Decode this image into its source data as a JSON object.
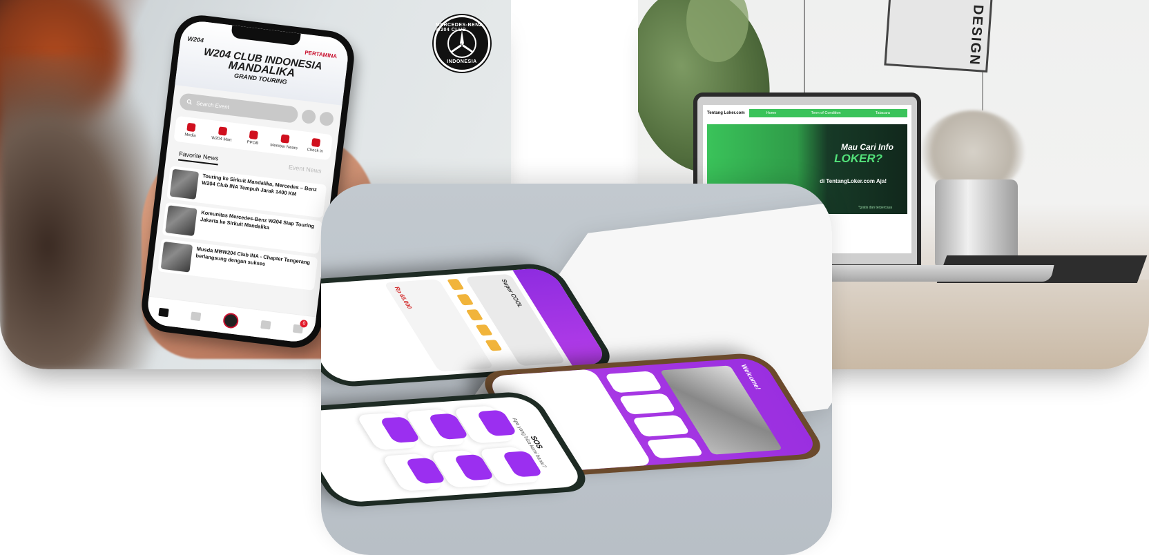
{
  "panel_a": {
    "badge": {
      "top": "MERCEDES-BENZ W204 CLUB",
      "bottom": "INDONESIA"
    },
    "app": {
      "brand_left": "W204",
      "brand_right": "PERTAMINA",
      "event_line1": "W204 CLUB INDONESIA",
      "event_line2": "MANDALIKA",
      "event_line3": "GRAND TOURING",
      "search_placeholder": "Search Event",
      "menu": [
        "Media",
        "W204 Mart",
        "PPOB",
        "Member Nears",
        "Check in"
      ],
      "tabs": [
        "Favorite News",
        "Event News"
      ],
      "news": [
        "Touring ke Sirkuit Mandalika, Mercedes – Benz W204 Club INA Tempuh Jarak 1400 KM",
        "Komunitas Mercedes-Benz W204 Siap Touring Jakarta ke Sirkuit Mandalika",
        "Musda MBW204 Club INA - Chapter Tangerang berlangsung dengan sukses"
      ],
      "notification_count": "0"
    }
  },
  "panel_b": {
    "poster_text": "DESIGN",
    "site": {
      "logo": "Tentang Loker.com",
      "nav": [
        "Home",
        "Term of Condition",
        "Tatacara"
      ],
      "hero_line1": "Mau Cari Info",
      "hero_line2": "LOKER?",
      "hero_line3": "di TentangLoker.com Aja!",
      "hero_note": "*gratis dan terpercaya"
    }
  },
  "panel_c": {
    "shop": {
      "promo": "Super COOL",
      "price": "Rp 65.000"
    },
    "home": {
      "welcome": "Welcome!"
    },
    "sos": {
      "title": "SOS",
      "subtitle": "Apa yang bisa kami bantu?"
    }
  }
}
